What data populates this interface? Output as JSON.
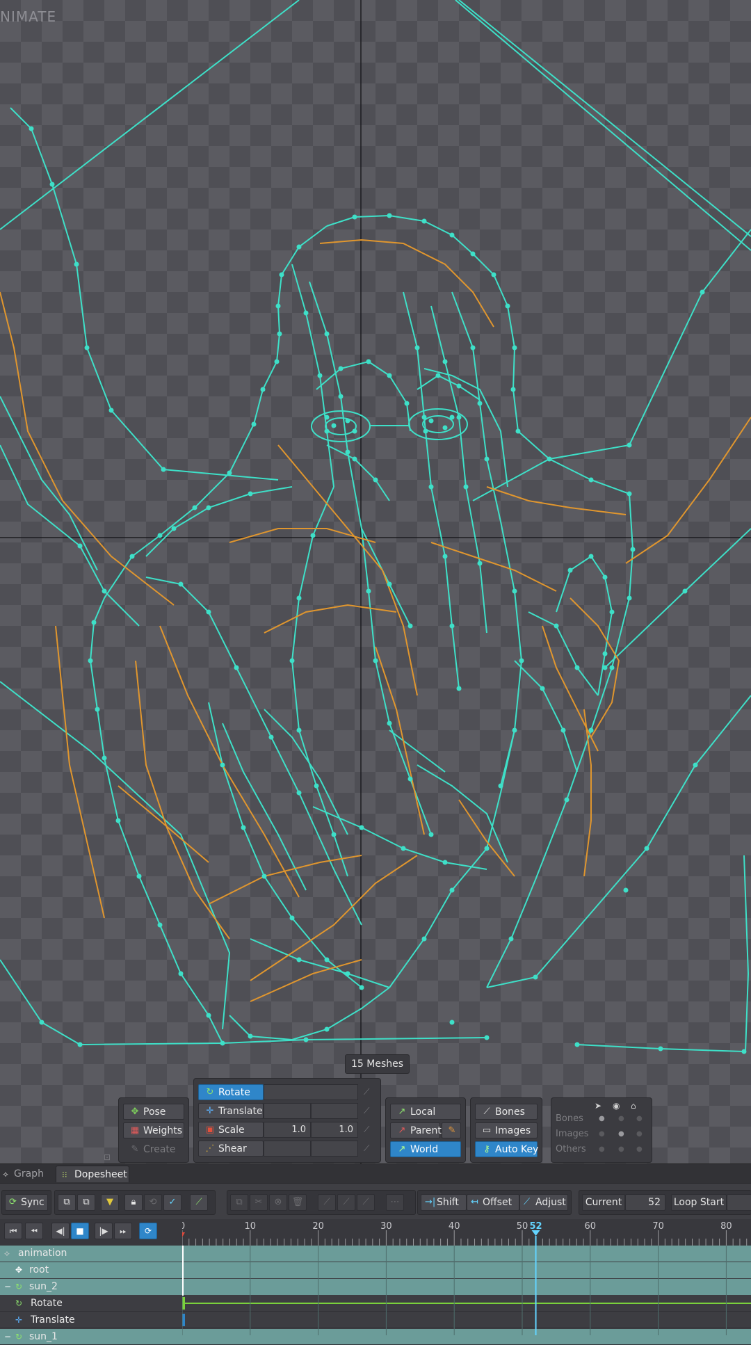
{
  "viewport": {
    "mode_label": "NIMATE",
    "mesh_count": "15 Meshes"
  },
  "tools": {
    "pose": "Pose",
    "weights": "Weights",
    "create": "Create",
    "rotate": "Rotate",
    "translate": "Translate",
    "scale": "Scale",
    "scale_x": "1.0",
    "scale_y": "1.0",
    "shear": "Shear",
    "local": "Local",
    "parent": "Parent",
    "world": "World",
    "bones": "Bones",
    "images": "Images",
    "auto_key": "Auto Key",
    "vis_bones": "Bones",
    "vis_images": "Images",
    "vis_others": "Others"
  },
  "tabs": {
    "graph": "Graph",
    "dopesheet": "Dopesheet"
  },
  "toolbar": {
    "sync": "Sync",
    "shift": "Shift",
    "offset": "Offset",
    "adjust": "Adjust",
    "current_label": "Current",
    "current_value": "52",
    "loop_start": "Loop Start"
  },
  "timeline": {
    "ticks": [
      "0",
      "10",
      "20",
      "30",
      "40",
      "50",
      "52",
      "60",
      "70",
      "80"
    ],
    "current_frame": 52
  },
  "tracks": [
    {
      "name": "animation"
    },
    {
      "name": "root"
    },
    {
      "name": "sun_2"
    },
    {
      "name": "Rotate"
    },
    {
      "name": "Translate"
    },
    {
      "name": "sun_1"
    }
  ],
  "colors": {
    "mesh": "#3ee0c8",
    "bone": "#e0962e",
    "accent": "#2f86c9"
  }
}
